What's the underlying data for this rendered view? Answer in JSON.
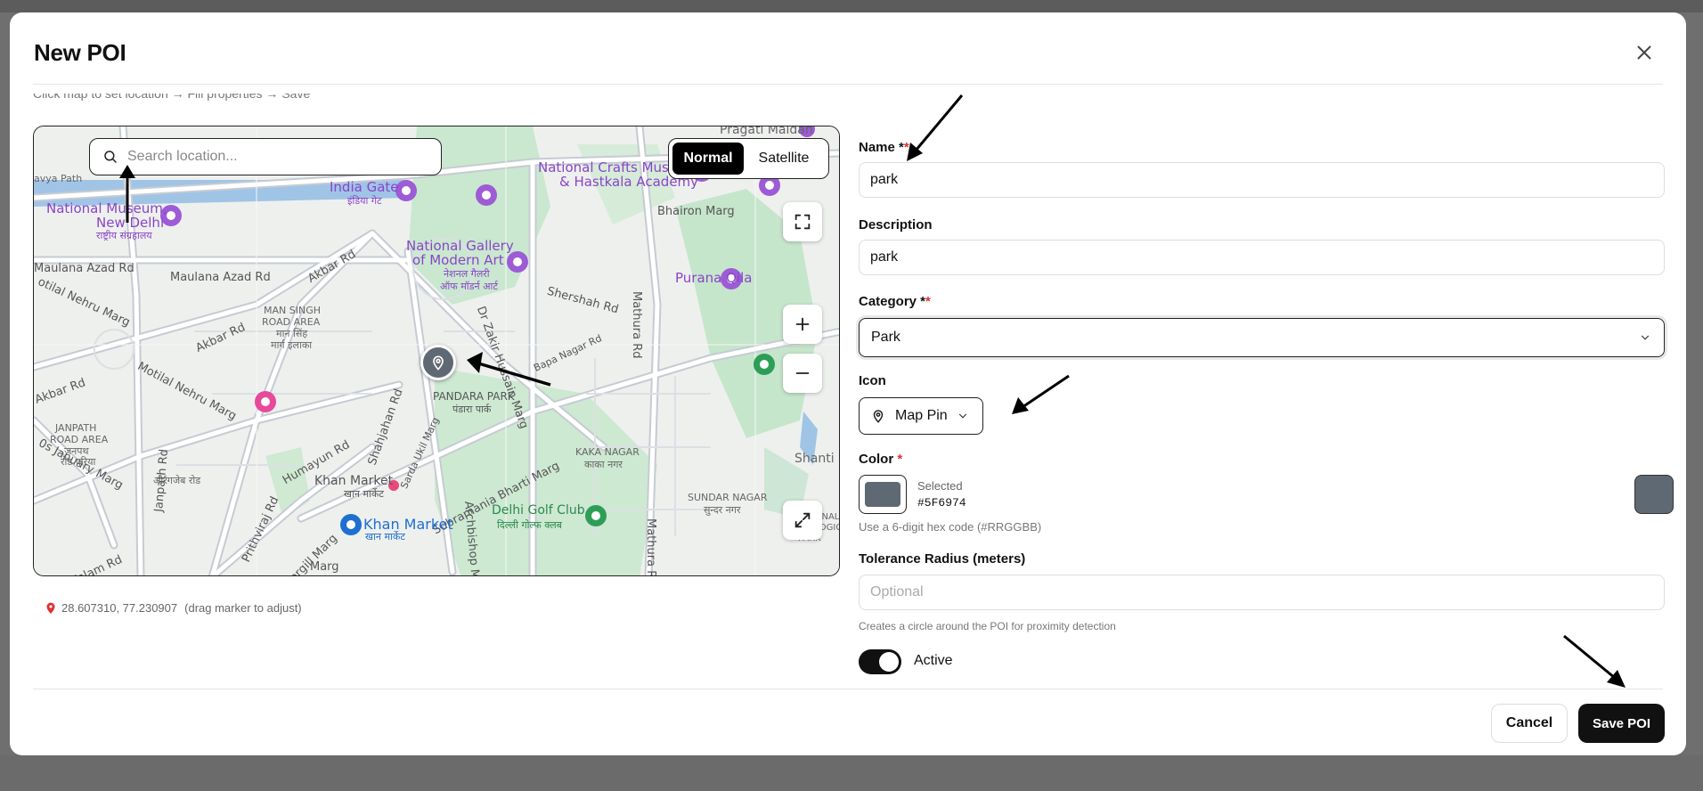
{
  "modal": {
    "title": "New POI",
    "hint": "Click map to set location → Fill properties → Save"
  },
  "map": {
    "search_placeholder": "Search location...",
    "type_normal": "Normal",
    "type_satellite": "Satellite",
    "labels": {
      "pragati_maidan": "Pragati Maidan",
      "national_crafts": "National Crafts Muse",
      "hastkala": "& Hastkala Academy",
      "india_gate": "India Gate",
      "india_gate_hi": "इंडिया गेट",
      "national_museum": "National Museum,",
      "new_delhi": "New Delhi",
      "rashtriya": "राष्ट्रीय संग्रहालय",
      "avya_path": "avya Path",
      "bhairon_marg": "Bhairon Marg",
      "ngma_1": "National Gallery",
      "ngma_2": "of Modern Art",
      "ngma_hi_1": "नेशनल गैलरी",
      "ngma_hi_2": "ऑफ मॉडर्न आर्ट",
      "maulana_azad": "Maulana Azad Rd",
      "maulana_azad_2": "Maulana Azad Rd",
      "akbar_rd": "Akbar Rd",
      "akbar_rd_2": "Akbar Rd",
      "akbar_rd_3": "Akbar Rd",
      "shershah": "Shershah Rd",
      "purana_qila": "Purana Qila",
      "man_singh_1": "MAN SINGH",
      "man_singh_2": "ROAD AREA",
      "man_singh_hi": "मान सिंह",
      "man_singh_hi_2": "मार्ग इलाका",
      "mathura_rd": "Mathura Rd",
      "mathura_rd_2": "Mathura R",
      "motilal_nehru": "Motilal Nehru Marg",
      "motilal_nehru_2": "otilal Nehru Marg",
      "shahjahan": "Shahjahan Rd",
      "dr_zakir": "Dr Zakir Hussain Marg",
      "bapa_nagar": "Bapa Nagar Rd",
      "pandara_park": "PANDARA PARK",
      "pandara_hi": "पंडारा पार्क",
      "pa_rd": "Pa...",
      "janpath_area_1": "JANPATH",
      "janpath_area_2": "ROAD AREA",
      "janpath_hi_1": "जनपथ",
      "janpath_hi_2": "रोड एरिया",
      "aurangzeb": "औरंगजेब रोड",
      "janpath": "Janpath Rd",
      "humayun": "Humayun Rd",
      "sardar": "Sarda Ukil Marg",
      "kaka_nagar": "KAKA NAGAR",
      "kaka_nagar_hi": "काका नगर",
      "shanti": "Shanti S",
      "subramania": "Subramania Bharti Marg",
      "khan_market": "Khan Market",
      "khan_market_hi": "खान मार्केट",
      "khan_market_blue": "Khan Market",
      "khan_market_blue_hi": "खान मार्केट",
      "sundar_nagar": "SUNDAR NAGAR",
      "sundar_nagar_hi": "सुन्दर नगर",
      "delhi_golf": "Delhi Golf Club",
      "delhi_golf_hi": "दिल्ली गोल्फ क्लब",
      "prithviraj": "Prithviraj Rd",
      "amrita_shergill": "Amrita Shergill Marg",
      "archbishop": "Archbishop M",
      "january_marg": "0s January Marg",
      "abdul_kalam": "Abdul Kalam Rd",
      "akbar_left": "Akbar Rd",
      "national_zoo_1": "NATIONAL",
      "national_zoo_2": "ZOOLOGIC",
      "national_zoo_3": "PARK",
      "rg_marg": "Marg",
      "otilal_left": "otilal Nehru Marg"
    },
    "coordinates": "28.607310, 77.230907",
    "coordinates_hint": "(drag marker to adjust)"
  },
  "form": {
    "name_label": "Name *",
    "name_req": "*",
    "name_value": "park",
    "description_label": "Description",
    "description_value": "park",
    "category_label": "Category *",
    "category_req": "*",
    "category_value": "Park",
    "icon_label": "Icon",
    "icon_value": "Map Pin",
    "color_label": "Color",
    "color_req": "*",
    "color_selected_label": "Selected",
    "color_value": "#5F6974",
    "color_hint": "Use a 6-digit hex code (#RRGGBB)",
    "tolerance_label": "Tolerance Radius (meters)",
    "tolerance_placeholder": "Optional",
    "tolerance_hint": "Creates a circle around the POI for proximity detection",
    "active_label": "Active",
    "active_on": true
  },
  "footer": {
    "cancel_label": "Cancel",
    "save_label": "Save POI"
  },
  "icons": [
    "close-icon",
    "search-icon",
    "fullscreen-icon",
    "plus-icon",
    "minus-icon",
    "expand-icon",
    "map-pin-icon",
    "chevron-down-icon",
    "location-dot-icon"
  ],
  "colors": {
    "accent": "#111111",
    "required": "#E03131",
    "poi_color": "#5F6974"
  }
}
